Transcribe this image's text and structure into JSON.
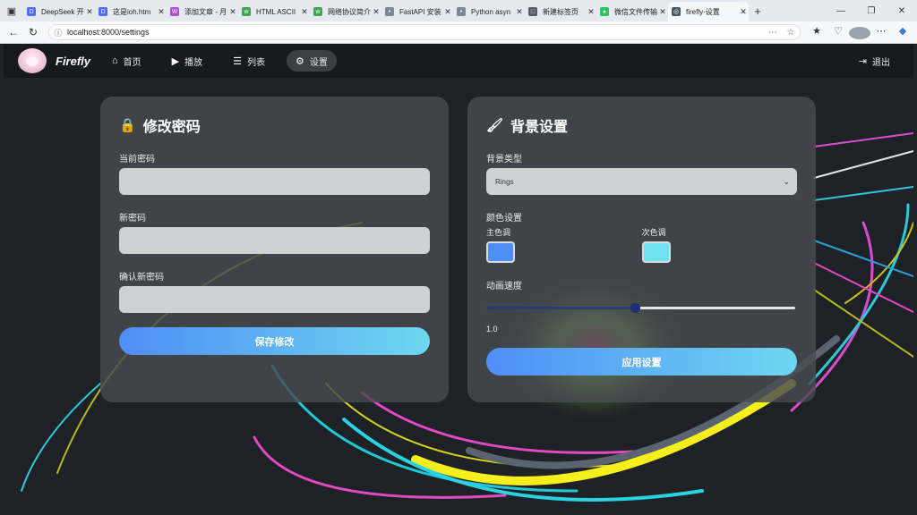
{
  "browser": {
    "tabs": [
      {
        "label": "DeepSeek 开",
        "color": "#4d6bfe",
        "glyph": "D"
      },
      {
        "label": "这是ioh.htm",
        "color": "#4d6bfe",
        "glyph": "D"
      },
      {
        "label": "添加文章 - 月",
        "color": "#b24bd9",
        "glyph": "W"
      },
      {
        "label": "HTML ASCII",
        "color": "#3aa757",
        "glyph": "w"
      },
      {
        "label": "网络协议简介",
        "color": "#3aa757",
        "glyph": "w"
      },
      {
        "label": "FastAPI 安装",
        "color": "#7a8796",
        "glyph": "•"
      },
      {
        "label": "Python asyn",
        "color": "#7a8796",
        "glyph": "•"
      },
      {
        "label": "新建标签页",
        "color": "#555b63",
        "glyph": "□"
      },
      {
        "label": "微信文件传输",
        "color": "#2ac25f",
        "glyph": "●"
      },
      {
        "label": "firefly-设置",
        "color": "#4a5563",
        "glyph": "◎",
        "active": true
      }
    ],
    "url": "localhost:8000/settings"
  },
  "nav": {
    "brand": "Firefly",
    "items": [
      {
        "label": "首页",
        "icon": "home-icon"
      },
      {
        "label": "播放",
        "icon": "play-icon"
      },
      {
        "label": "列表",
        "icon": "list-icon"
      },
      {
        "label": "设置",
        "icon": "gear-icon",
        "active": true
      }
    ],
    "logout": "退出"
  },
  "password_card": {
    "title": "修改密码",
    "current_label": "当前密码",
    "new_label": "新密码",
    "confirm_label": "确认新密码",
    "save_button": "保存修改"
  },
  "bg_card": {
    "title": "背景设置",
    "type_label": "背景类型",
    "type_value": "Rings",
    "color_section_label": "颜色设置",
    "primary_label": "主色调",
    "secondary_label": "次色调",
    "primary_color": "#4f8ef7",
    "secondary_color": "#6ee1f0",
    "speed_label": "动画速度",
    "speed_value": "1.0",
    "speed_fraction": 0.48,
    "apply_button": "应用设置"
  }
}
